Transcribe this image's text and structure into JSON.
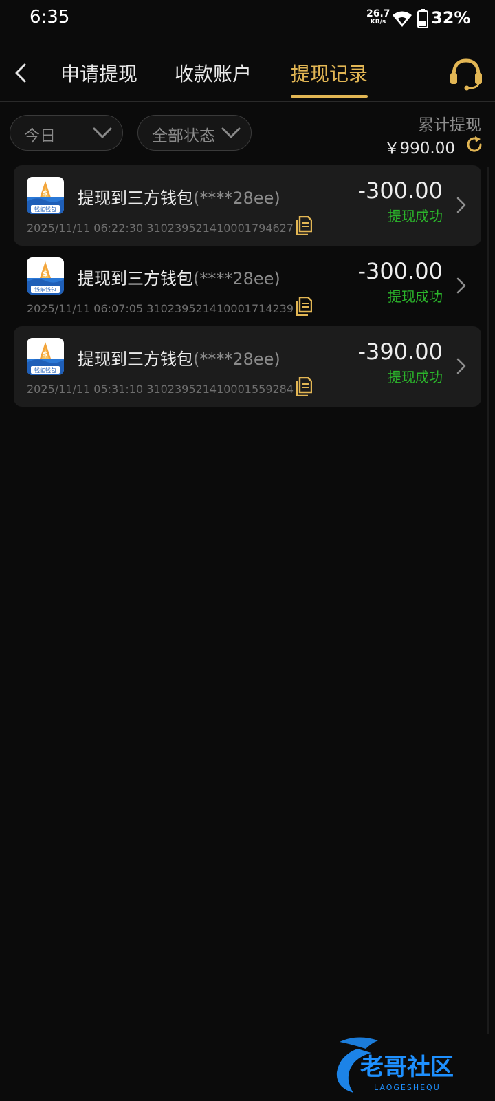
{
  "status_bar": {
    "time": "6:35",
    "net_speed_value": "26.7",
    "net_speed_unit": "KB/s",
    "battery": "32%"
  },
  "nav": {
    "tabs": [
      {
        "label": "申请提现",
        "active": false
      },
      {
        "label": "收款账户",
        "active": false
      },
      {
        "label": "提现记录",
        "active": true
      }
    ],
    "accent_color": "#e2b654"
  },
  "filters": {
    "date": "今日",
    "status": "全部状态"
  },
  "summary": {
    "label": "累计提现",
    "amount": "￥990.00"
  },
  "records": [
    {
      "title": "提现到三方钱包",
      "account": "(****28ee)",
      "datetime": "2025/11/11 06:22:30",
      "order_id": "3102395214100017946​27",
      "amount": "-300.00",
      "status": "提现成功"
    },
    {
      "title": "提现到三方钱包",
      "account": "(****28ee)",
      "datetime": "2025/11/11 06:07:05",
      "order_id": "310239521410001714239",
      "amount": "-300.00",
      "status": "提现成功"
    },
    {
      "title": "提现到三方钱包",
      "account": "(****28ee)",
      "datetime": "2025/11/11 05:31:10",
      "order_id": "310239521410001559284",
      "amount": "-390.00",
      "status": "提现成功"
    }
  ],
  "wallet_logo_text": "钱能钱包",
  "watermark": {
    "text": "老哥社区",
    "sub": "LAOGESHEQU"
  },
  "colors": {
    "success": "#2bb52b",
    "background": "#0b0b0b",
    "card": "#1c1c1c"
  }
}
